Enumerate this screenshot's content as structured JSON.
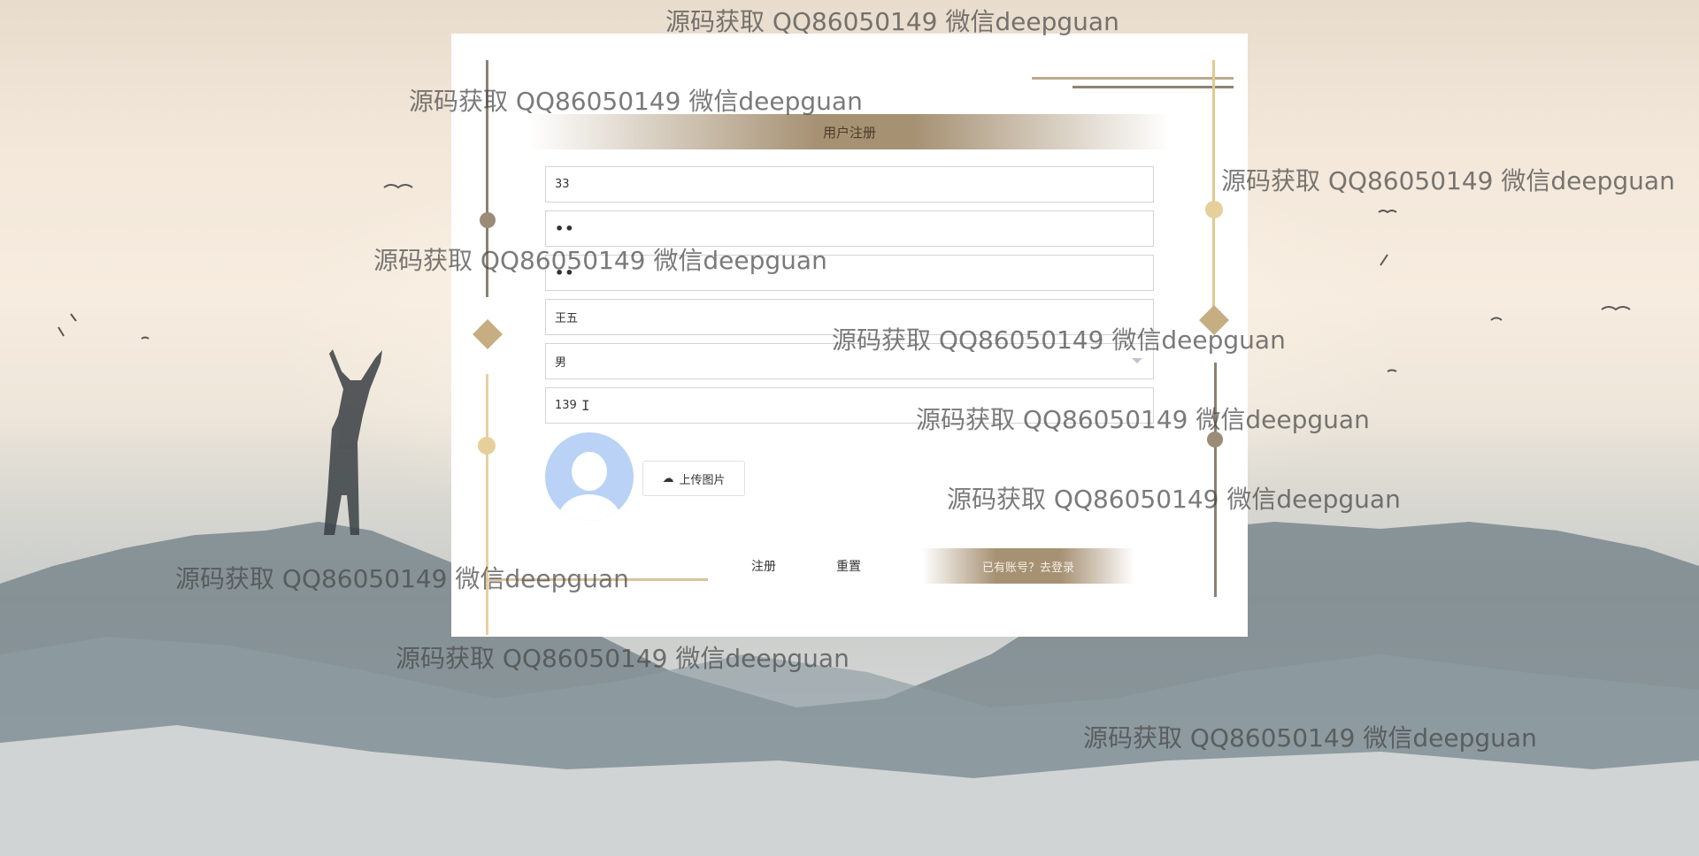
{
  "form": {
    "title": "用户注册",
    "username_value": "33",
    "password_value": "••",
    "confirm_password_value": "••",
    "name_value": "王五",
    "gender_selected": "男",
    "phone_value": "139"
  },
  "upload": {
    "label": "上传图片",
    "icon": "cloud-upload-icon"
  },
  "buttons": {
    "register": "注册",
    "reset": "重置",
    "go_login": "已有账号？去登录"
  },
  "watermark_text": "源码获取 QQ86050149 微信deepguan",
  "colors": {
    "accent_brown": "#a69173",
    "gold": "#e4c98f",
    "avatar_blue": "#b9d2f5"
  }
}
